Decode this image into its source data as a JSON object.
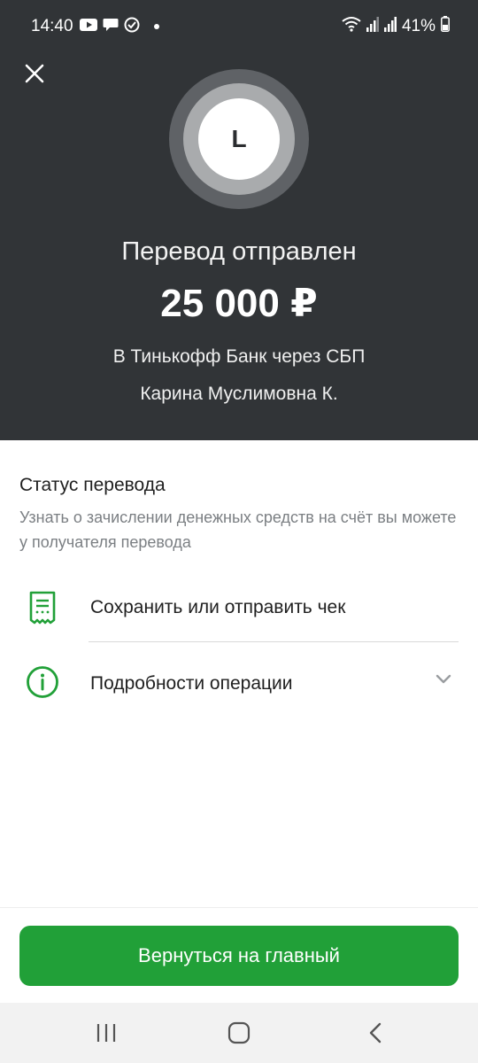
{
  "status_bar": {
    "time": "14:40",
    "battery": "41%",
    "icons_left": [
      "youtube-icon",
      "chat-icon",
      "check-circle-icon",
      "dot-icon"
    ],
    "icons_right": [
      "wifi-icon",
      "signal-icon",
      "signal-icon",
      "battery-icon"
    ]
  },
  "header": {
    "close_icon": "close-icon",
    "avatar_letter": "L",
    "title": "Перевод отправлен",
    "amount": "25 000 ₽",
    "bank": "В Тинькофф Банк через СБП",
    "recipient": "Карина Муслимовна К."
  },
  "status": {
    "title": "Статус перевода",
    "description": "Узнать о зачислении денежных средств на счёт вы можете у получателя перевода"
  },
  "actions": [
    {
      "icon": "receipt-icon",
      "label": "Сохранить или отправить чек"
    },
    {
      "icon": "info-icon",
      "label": "Подробности операции"
    }
  ],
  "main_button": {
    "label": "Вернуться на главный"
  },
  "colors": {
    "header_bg": "#313437",
    "accent": "#21a038",
    "muted_text": "#7b7f83"
  },
  "nav_bar": {
    "icons": [
      "recent-apps-icon",
      "home-icon",
      "back-icon"
    ]
  }
}
